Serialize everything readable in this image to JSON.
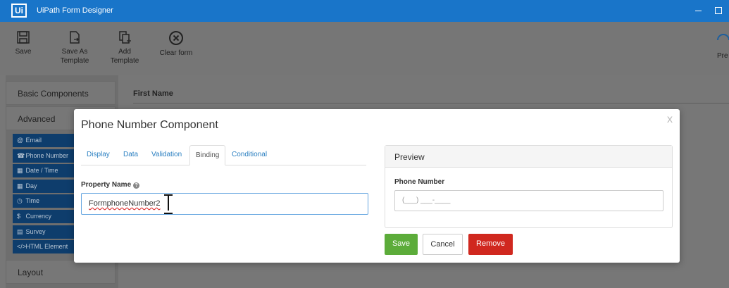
{
  "app": {
    "logo": "Ui",
    "title": "UiPath Form Designer"
  },
  "toolbar": {
    "buttons": [
      {
        "label_line1": "Save",
        "label_line2": "",
        "icon": "save-icon"
      },
      {
        "label_line1": "Save As",
        "label_line2": "Template",
        "icon": "save-as-template-icon"
      },
      {
        "label_line1": "Add",
        "label_line2": "Template",
        "icon": "add-template-icon"
      },
      {
        "label_line1": "Clear form",
        "label_line2": "",
        "icon": "clear-form-icon"
      }
    ],
    "right_label": "Pre"
  },
  "sidebar": {
    "basic": "Basic Components",
    "advanced": "Advanced",
    "layout": "Layout",
    "components": [
      {
        "icon": "@",
        "label": "Email"
      },
      {
        "icon": "☎",
        "label": "Phone Number"
      },
      {
        "icon": "▦",
        "label": "Date / Time"
      },
      {
        "icon": "▦",
        "label": "Day"
      },
      {
        "icon": "◷",
        "label": "Time"
      },
      {
        "icon": "$",
        "label": "Currency"
      },
      {
        "icon": "▤",
        "label": "Survey"
      },
      {
        "icon": "</>",
        "label": "HTML Element"
      }
    ]
  },
  "canvas": {
    "first_label": "First Name"
  },
  "modal": {
    "title": "Phone Number Component",
    "close": "x",
    "tabs": [
      "Display",
      "Data",
      "Validation",
      "Binding",
      "Conditional"
    ],
    "active_tab": "Binding",
    "property_label": "Property Name",
    "help": "?",
    "property_value": "FormphoneNumber2",
    "preview": {
      "title": "Preview",
      "field_label": "Phone Number",
      "mask": "(___) ___-____"
    },
    "buttons": {
      "save": "Save",
      "cancel": "Cancel",
      "remove": "Remove"
    }
  },
  "colors": {
    "titlebar": "#1975c9",
    "save_button": "#5cac3a",
    "remove_button": "#d0281f",
    "tab_link": "#2a7fc1"
  }
}
